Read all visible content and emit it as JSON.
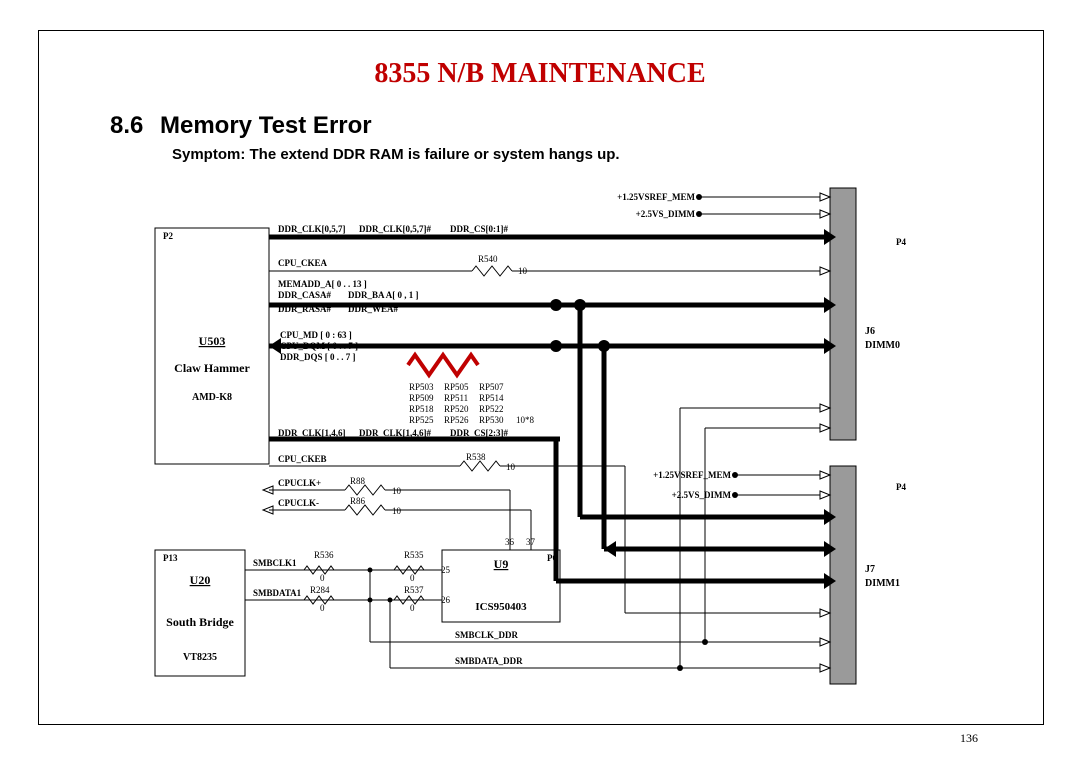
{
  "title": "8355 N/B MAINTENANCE",
  "section_num": "8.6",
  "section_title": "Memory Test Error",
  "symptom": "Symptom: The extend DDR RAM is failure or system hangs up.",
  "page_num": "136",
  "chips": {
    "u503": {
      "ref": "U503",
      "name": "Claw Hammer",
      "part": "AMD-K8",
      "page": "P2"
    },
    "u20": {
      "ref": "U20",
      "name": "South Bridge",
      "part": "VT8235",
      "page": "P13"
    },
    "u9": {
      "ref": "U9",
      "name": "ICS950403",
      "page": "P6"
    },
    "dimm0": {
      "ref": "J6",
      "name": "DIMM0",
      "page": "P4"
    },
    "dimm1": {
      "ref": "J7",
      "name": "DIMM1",
      "page": "P4"
    }
  },
  "signals": {
    "vref0": "+1.25VSREF_MEM",
    "vdimm": "+2.5VS_DIMM",
    "ddr_clk0": "DDR_CLK[0,5,7]",
    "ddr_clk0n": "DDR_CLK[0,5,7]#",
    "ddr_cs0": "DDR_CS[0:1]#",
    "cpu_ckea": "CPU_CKEA",
    "memadd": "MEMADD_A[ 0 . . 13 ]",
    "ddr_casa": "DDR_CASA#",
    "ddr_ba": "DDR_BA A[ 0 , 1 ]",
    "ddr_rasa": "DDR_RASA#",
    "ddr_wea": "DDR_WEA#",
    "cpu_md": "CPU_MD [ 0 : 63 ]",
    "cpu_dqm": "CPU_DQM [ 0 . . 7 ]",
    "ddr_dqs": "DDR_DQS [ 0 . . 7 ]",
    "ddr_clk1": "DDR_CLK[1,4,6]",
    "ddr_clk1n": "DDR_CLK[1,4,6]#",
    "ddr_cs1": "DDR_CS[2:3]#",
    "cpu_ckeb": "CPU_CKEB",
    "cpuclk_p": "CPUCLK+",
    "cpuclk_n": "CPUCLK-",
    "smbclk1": "SMBCLK1",
    "smbdata1": "SMBDATA1",
    "smbclk_ddr": "SMBCLK_DDR",
    "smbdata_ddr": "SMBDATA_DDR"
  },
  "resistors": {
    "r540": "R540",
    "r540_v": "10",
    "r538": "R538",
    "r538_v": "10",
    "r88": "R88",
    "r88_v": "10",
    "r86": "R86",
    "r86_v": "10",
    "r536": "R536",
    "r535": "R535",
    "r284": "R284",
    "r537": "R537",
    "pins36": "36",
    "pins37": "37",
    "pins25": "25",
    "pins26": "26",
    "res0": "0",
    "rp_note": "10*8",
    "rp": [
      "RP503",
      "RP505",
      "RP507",
      "RP509",
      "RP511",
      "RP514",
      "RP518",
      "RP520",
      "RP522",
      "RP525",
      "RP526",
      "RP530"
    ]
  }
}
